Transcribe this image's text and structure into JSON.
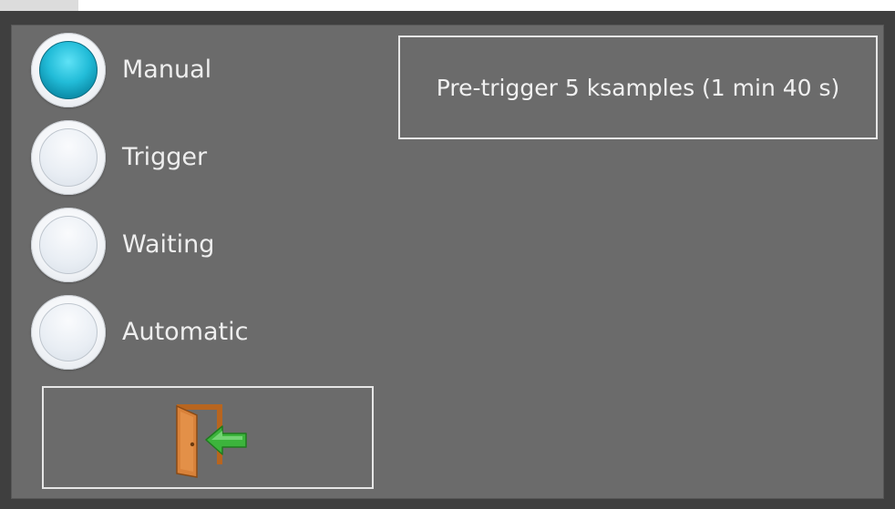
{
  "modes": {
    "selected": "Manual",
    "items": [
      {
        "label": "Manual",
        "selected": true
      },
      {
        "label": "Trigger",
        "selected": false
      },
      {
        "label": "Waiting",
        "selected": false
      },
      {
        "label": "Automatic",
        "selected": false
      }
    ]
  },
  "exit_button": {
    "icon": "exit-door-icon"
  },
  "status": {
    "text": "Pre-trigger 5 ksamples (1 min 40 s)"
  },
  "colors": {
    "panel_bg": "#6b6b6b",
    "selected_radio": "#22bcd8",
    "door": "#c8742c",
    "arrow": "#3cb43c"
  }
}
